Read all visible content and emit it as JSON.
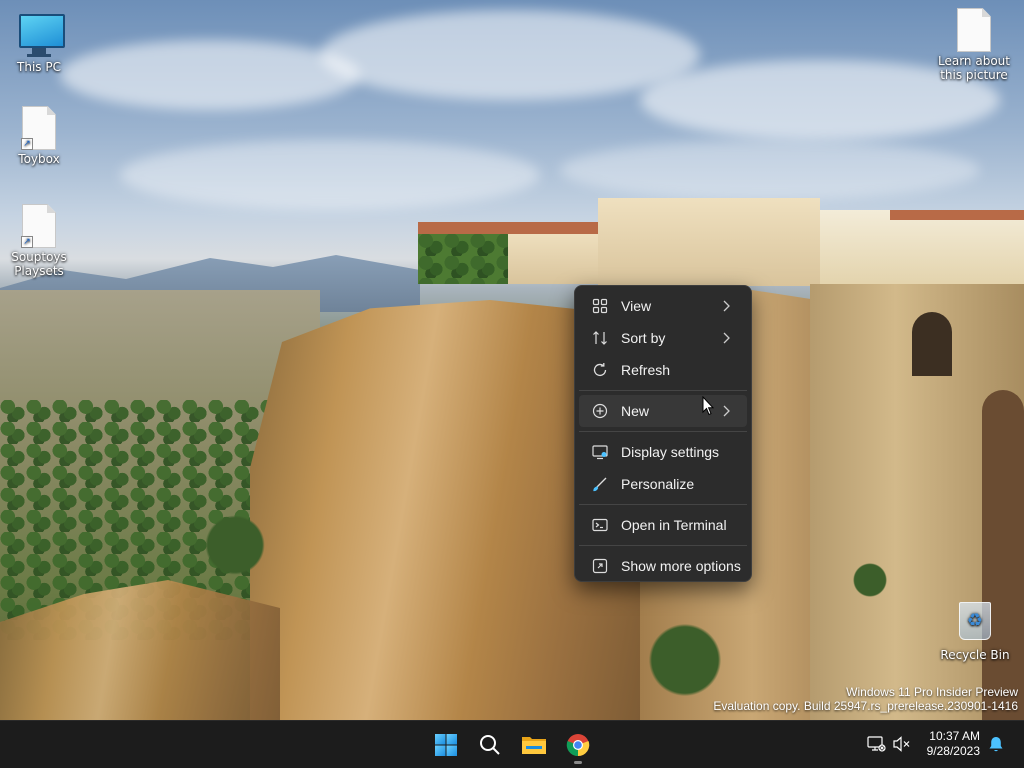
{
  "desktop": {
    "icons": [
      {
        "label": "This PC"
      },
      {
        "label": "Toybox"
      },
      {
        "label": "Souptoys Playsets"
      },
      {
        "label": "Learn about this picture"
      },
      {
        "label": "Recycle Bin"
      }
    ]
  },
  "context_menu": {
    "items": [
      {
        "label": "View",
        "icon": "grid-icon",
        "submenu": true
      },
      {
        "label": "Sort by",
        "icon": "sort-icon",
        "submenu": true
      },
      {
        "label": "Refresh",
        "icon": "refresh-icon",
        "submenu": false
      },
      {
        "label": "New",
        "icon": "plus-circle-icon",
        "submenu": true
      },
      {
        "label": "Display settings",
        "icon": "display-settings-icon",
        "submenu": false
      },
      {
        "label": "Personalize",
        "icon": "brush-icon",
        "submenu": false
      },
      {
        "label": "Open in Terminal",
        "icon": "terminal-icon",
        "submenu": false
      },
      {
        "label": "Show more options",
        "icon": "more-options-icon",
        "submenu": false
      }
    ]
  },
  "watermark": {
    "line1": "Windows 11 Pro Insider Preview",
    "line2": "Evaluation copy. Build 25947.rs_prerelease.230901-1416"
  },
  "taskbar": {
    "apps": [
      "windows-start-icon",
      "search-icon",
      "file-explorer-icon",
      "chrome-icon"
    ],
    "time": "10:37 AM",
    "date": "9/28/2023"
  },
  "colors": {
    "menu_bg": "#2c2c2c",
    "taskbar_bg": "#1c1c1c",
    "accent": "#0078d4"
  }
}
